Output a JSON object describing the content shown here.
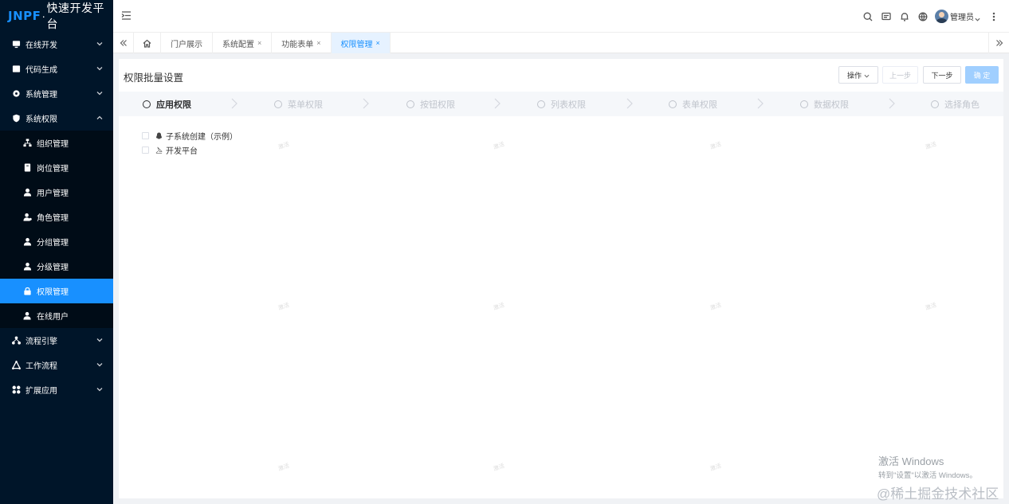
{
  "logo": {
    "brand": "JNPF",
    "dot": "·",
    "name": "快速开发平台"
  },
  "sidebar": {
    "items": [
      {
        "label": "在线开发",
        "icon": "desktop-icon",
        "expanded": false
      },
      {
        "label": "代码生成",
        "icon": "code-icon",
        "expanded": false
      },
      {
        "label": "系统管理",
        "icon": "gear-icon",
        "expanded": false
      },
      {
        "label": "系统权限",
        "icon": "shield-icon",
        "expanded": true
      }
    ],
    "sub_items": [
      {
        "label": "组织管理",
        "icon": "org-icon"
      },
      {
        "label": "岗位管理",
        "icon": "post-icon"
      },
      {
        "label": "用户管理",
        "icon": "user-icon"
      },
      {
        "label": "角色管理",
        "icon": "role-icon"
      },
      {
        "label": "分组管理",
        "icon": "group-icon"
      },
      {
        "label": "分级管理",
        "icon": "level-icon"
      },
      {
        "label": "权限管理",
        "icon": "lock-icon",
        "active": true
      },
      {
        "label": "在线用户",
        "icon": "online-user-icon"
      }
    ],
    "bottom_items": [
      {
        "label": "流程引擎",
        "icon": "flow-icon"
      },
      {
        "label": "工作流程",
        "icon": "workflow-icon"
      },
      {
        "label": "扩展应用",
        "icon": "apps-icon"
      }
    ]
  },
  "header": {
    "user_name": "管理员",
    "icons": [
      "search-icon",
      "message-icon",
      "bell-icon",
      "globe-icon",
      "more-icon"
    ]
  },
  "tabs": [
    {
      "label": "门户展示",
      "closable": false
    },
    {
      "label": "系统配置",
      "closable": true
    },
    {
      "label": "功能表单",
      "closable": true
    },
    {
      "label": "权限管理",
      "closable": true,
      "active": true
    }
  ],
  "tab_close_glyph": "×",
  "card": {
    "title": "权限批量设置",
    "buttons": {
      "operate": "操作",
      "prev": "上一步",
      "next": "下一步",
      "confirm": "确 定"
    }
  },
  "steps": [
    "应用权限",
    "菜单权限",
    "按钮权限",
    "列表权限",
    "表单权限",
    "数据权限",
    "选择角色"
  ],
  "current_step": 0,
  "tree": [
    {
      "label": "子系统创建（示例）",
      "icon": "penguin-icon"
    },
    {
      "label": "开发平台",
      "icon": "compass-icon"
    }
  ],
  "watermark_text": "激活",
  "windows_activation": {
    "line1": "激活 Windows",
    "line2": "转到\"设置\"以激活 Windows。"
  },
  "site_watermark": "@稀土掘金技术社区",
  "colors": {
    "sidebar_bg": "#001529",
    "accent": "#1890ff",
    "confirm_disabled": "#a0cfff"
  }
}
